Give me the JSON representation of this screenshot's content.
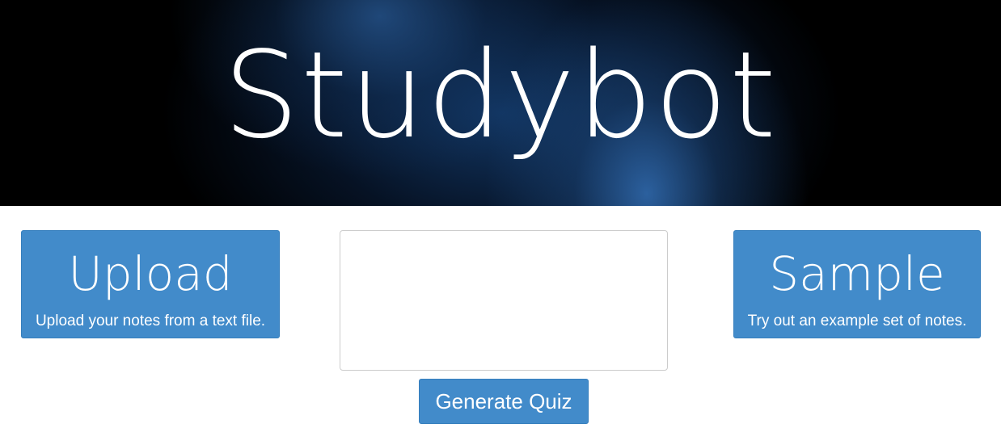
{
  "header": {
    "title": "Studybot"
  },
  "upload": {
    "title": "Upload",
    "subtitle": "Upload your notes from a text file."
  },
  "notes": {
    "value": "",
    "placeholder": ""
  },
  "sample": {
    "title": "Sample",
    "subtitle": "Try out an example set of notes."
  },
  "actions": {
    "generate_label": "Generate Quiz"
  },
  "colors": {
    "accent": "#428bca",
    "header_background": "#000000",
    "header_glow": "#2d5f99"
  }
}
